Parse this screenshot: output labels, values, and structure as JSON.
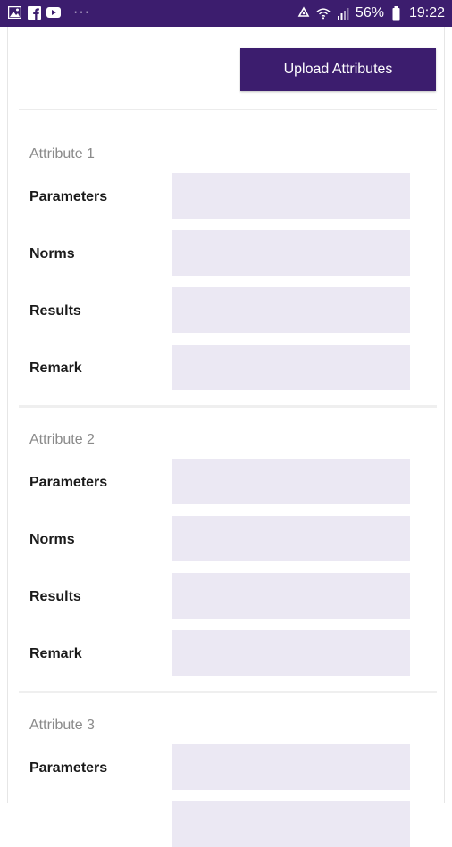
{
  "status_bar": {
    "battery_percent": "56%",
    "time": "19:22",
    "left_icons": [
      "gallery-icon",
      "facebook-icon",
      "youtube-icon"
    ],
    "overflow": "···",
    "background": "#3c1d6e"
  },
  "toolbar": {
    "upload_label": "Upload Attributes",
    "accent": "#3c1d6e"
  },
  "field_background": "#ebe8f3",
  "attributes": [
    {
      "title": "Attribute 1",
      "fields": [
        {
          "label": "Parameters",
          "value": ""
        },
        {
          "label": "Norms",
          "value": ""
        },
        {
          "label": "Results",
          "value": ""
        },
        {
          "label": "Remark",
          "value": ""
        }
      ]
    },
    {
      "title": "Attribute 2",
      "fields": [
        {
          "label": "Parameters",
          "value": ""
        },
        {
          "label": "Norms",
          "value": ""
        },
        {
          "label": "Results",
          "value": ""
        },
        {
          "label": "Remark",
          "value": ""
        }
      ]
    },
    {
      "title": "Attribute 3",
      "fields": [
        {
          "label": "Parameters",
          "value": ""
        }
      ]
    }
  ]
}
